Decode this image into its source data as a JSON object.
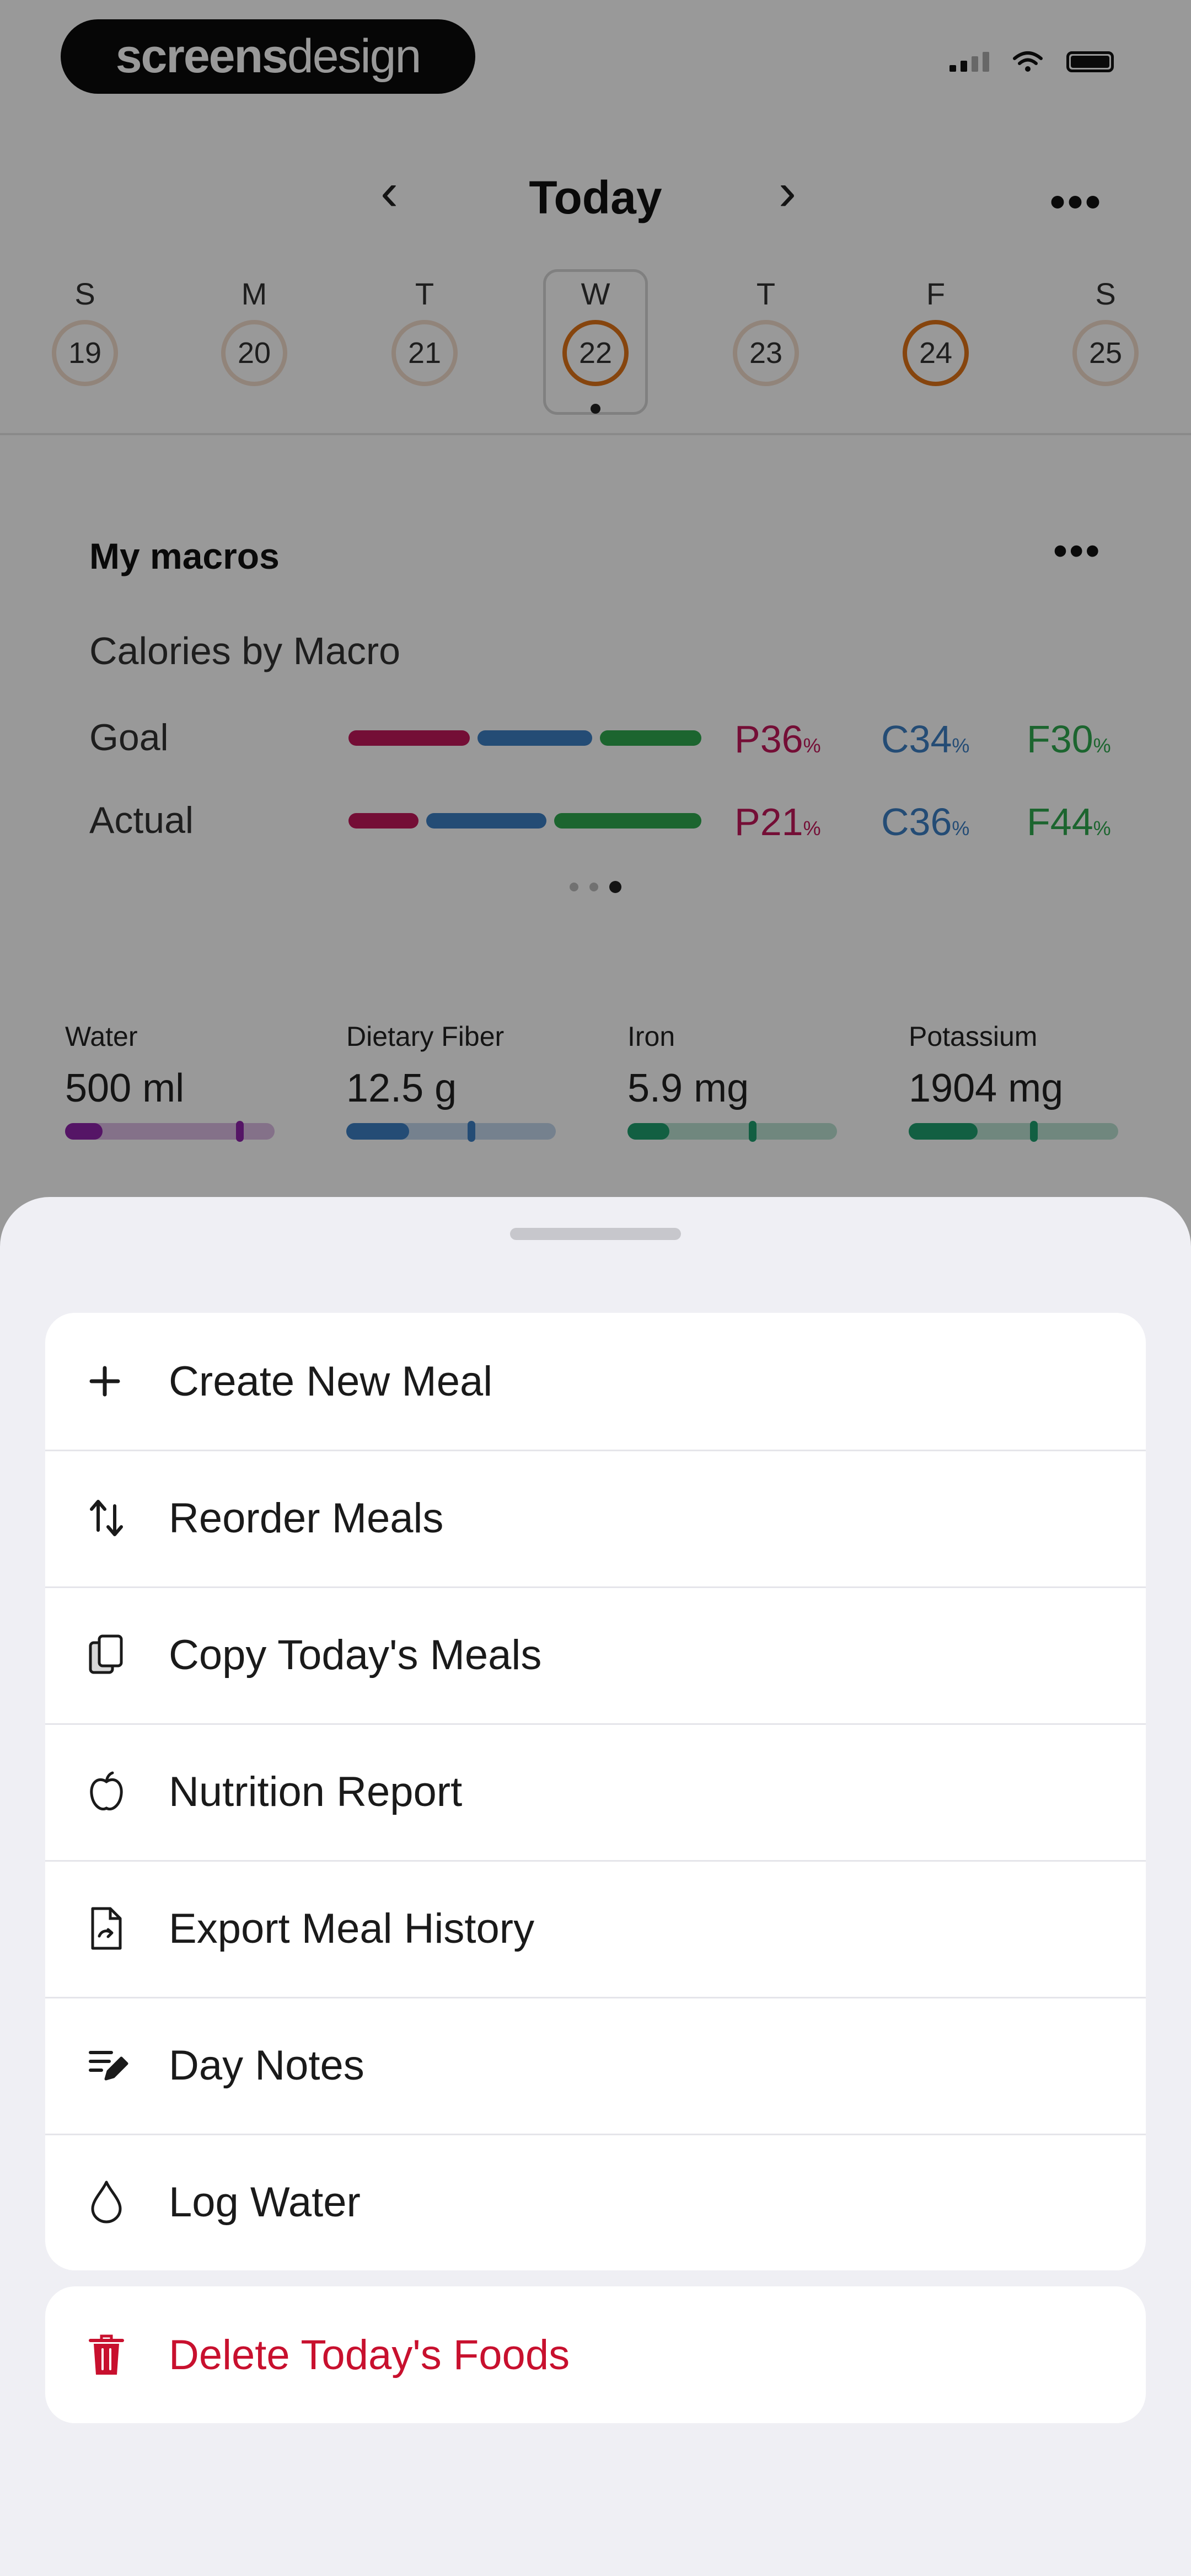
{
  "status_bar": {
    "logo_bold": "screens",
    "logo_light": "design"
  },
  "header": {
    "prev_glyph": "‹",
    "title": "Today",
    "next_glyph": "›",
    "more_glyph": "•••"
  },
  "week": [
    {
      "dow": "S",
      "date": "19",
      "state": "empty"
    },
    {
      "dow": "M",
      "date": "20",
      "state": "empty"
    },
    {
      "dow": "T",
      "date": "21",
      "state": "empty"
    },
    {
      "dow": "W",
      "date": "22",
      "state": "partial",
      "selected": true
    },
    {
      "dow": "T",
      "date": "23",
      "state": "empty"
    },
    {
      "dow": "F",
      "date": "24",
      "state": "partial"
    },
    {
      "dow": "S",
      "date": "25",
      "state": "empty"
    }
  ],
  "macros": {
    "title": "My macros",
    "more_glyph": "•••",
    "subtitle": "Calories by Macro",
    "rows": [
      {
        "label": "Goal",
        "p": "P36",
        "c": "C34",
        "f": "F30",
        "unit": "%",
        "p_value": 36,
        "c_value": 34,
        "f_value": 30
      },
      {
        "label": "Actual",
        "p": "P21",
        "c": "C36",
        "f": "F44",
        "unit": "%",
        "p_value": 21,
        "c_value": 36,
        "f_value": 44
      }
    ],
    "colors": {
      "protein": "#c2185b",
      "carbs": "#3d7fc4",
      "fat": "#2fa84f"
    }
  },
  "nutrients": [
    {
      "label": "Water",
      "value": "500 ml",
      "fraction": 0.18,
      "color": "#8e24aa"
    },
    {
      "label": "Dietary Fiber",
      "value": "12.5 g",
      "fraction": 0.3,
      "color": "#3d7fc4"
    },
    {
      "label": "Iron",
      "value": "5.9 mg",
      "fraction": 0.2,
      "color": "#1e9e6e"
    },
    {
      "label": "Potassium",
      "value": "1904 mg",
      "fraction": 0.33,
      "color": "#1e9e6e"
    }
  ],
  "sheet": {
    "items": [
      {
        "name": "create-new-meal",
        "label": "Create New Meal",
        "icon": "plus-icon"
      },
      {
        "name": "reorder-meals",
        "label": "Reorder Meals",
        "icon": "reorder-arrows-icon"
      },
      {
        "name": "copy-todays-meals",
        "label": "Copy Today's Meals",
        "icon": "copy-icon"
      },
      {
        "name": "nutrition-report",
        "label": "Nutrition Report",
        "icon": "apple-icon"
      },
      {
        "name": "export-meal-history",
        "label": "Export Meal History",
        "icon": "export-document-icon"
      },
      {
        "name": "day-notes",
        "label": "Day Notes",
        "icon": "notes-pencil-icon"
      },
      {
        "name": "log-water",
        "label": "Log Water",
        "icon": "water-drop-icon"
      }
    ],
    "danger_item": {
      "name": "delete-todays-foods",
      "label": "Delete Today's Foods",
      "icon": "trash-icon",
      "color": "#c8102e"
    }
  }
}
